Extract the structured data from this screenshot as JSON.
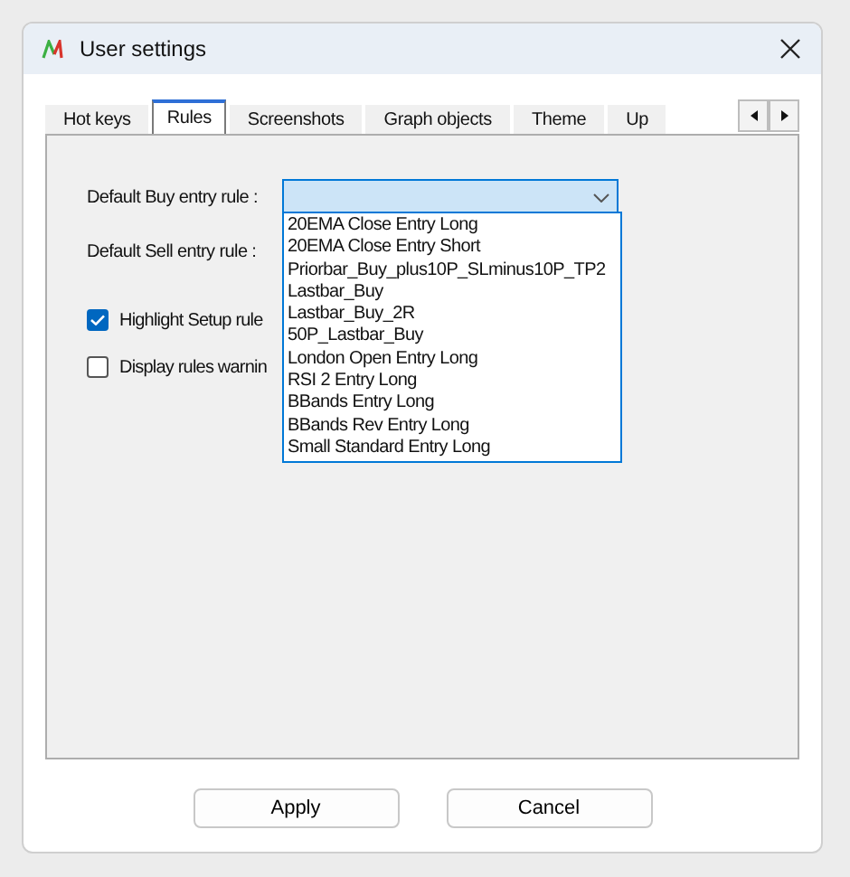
{
  "window": {
    "title": "User settings"
  },
  "tabs": [
    {
      "label": "Hot keys",
      "selected": false
    },
    {
      "label": "Rules",
      "selected": true
    },
    {
      "label": "Screenshots",
      "selected": false
    },
    {
      "label": "Graph objects",
      "selected": false
    },
    {
      "label": "Theme",
      "selected": false
    },
    {
      "label": "Up",
      "selected": false
    }
  ],
  "rules": {
    "buy_label": "Default Buy entry rule :",
    "sell_label": "Default Sell entry rule :",
    "dropdown_options": [
      "20EMA Close Entry Long",
      "20EMA Close Entry Short",
      "Priorbar_Buy_plus10P_SLminus10P_TP2",
      "Lastbar_Buy",
      "Lastbar_Buy_2R",
      "50P_Lastbar_Buy",
      "London Open Entry Long",
      "RSI 2 Entry Long",
      "BBands Entry Long",
      "BBands Rev Entry Long",
      "Small Standard Entry Long"
    ],
    "checkboxes": [
      {
        "label": "Highlight Setup rule",
        "checked": true
      },
      {
        "label": "Display rules warnin",
        "checked": false
      }
    ]
  },
  "buttons": [
    "Apply",
    "Cancel"
  ]
}
